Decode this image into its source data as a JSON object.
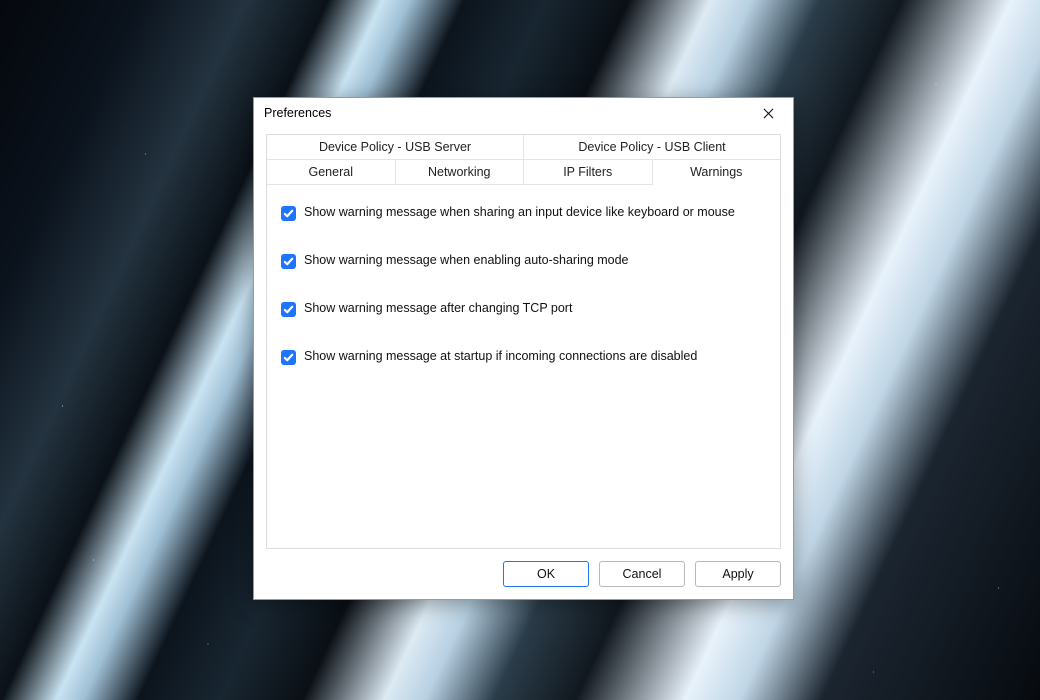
{
  "dialog": {
    "title": "Preferences",
    "tabs_row1": [
      {
        "label": "Device Policy - USB Server"
      },
      {
        "label": "Device Policy - USB Client"
      }
    ],
    "tabs_row2": [
      {
        "label": "General"
      },
      {
        "label": "Networking"
      },
      {
        "label": "IP Filters"
      },
      {
        "label": "Warnings",
        "active": true
      }
    ],
    "options": [
      {
        "label": "Show warning message when sharing an input device like keyboard or mouse",
        "checked": true
      },
      {
        "label": "Show warning message when enabling auto-sharing mode",
        "checked": true
      },
      {
        "label": "Show warning message after changing TCP port",
        "checked": true
      },
      {
        "label": "Show warning message at startup if incoming connections are disabled",
        "checked": true
      }
    ],
    "buttons": {
      "ok": "OK",
      "cancel": "Cancel",
      "apply": "Apply"
    }
  }
}
